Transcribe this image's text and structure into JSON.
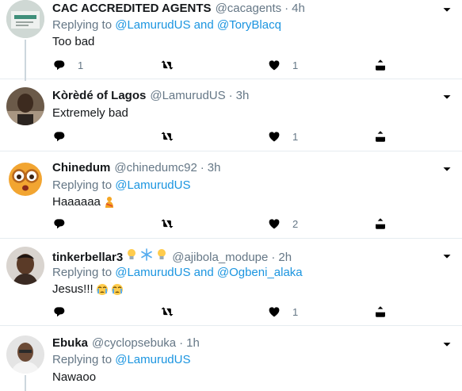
{
  "tweets": [
    {
      "name": "CAC ACCREDITED AGENTS",
      "handle": "@cacagents",
      "separator": "·",
      "time": "4h",
      "replying_prefix": "Replying to ",
      "reply_users": "@LamurudUS and @ToryBlacq",
      "text": "Too bad",
      "reply_count": "1",
      "retweet_count": "",
      "like_count": "1"
    },
    {
      "name": "Kòrèdé of Lagos",
      "handle": "@LamurudUS",
      "separator": "·",
      "time": "3h",
      "text": "Extremely bad",
      "reply_count": "",
      "retweet_count": "",
      "like_count": "1"
    },
    {
      "name": "Chinedum",
      "handle": "@chinedumc92",
      "separator": "·",
      "time": "3h",
      "replying_prefix": "Replying to ",
      "reply_users": "@LamurudUS",
      "text": "Haaaaaa",
      "reply_count": "",
      "retweet_count": "",
      "like_count": "2"
    },
    {
      "name": "tinkerbellar3",
      "handle": "@ajibola_modupe",
      "separator": "·",
      "time": "2h",
      "replying_prefix": "Replying to ",
      "reply_users": "@LamurudUS and @Ogbeni_alaka",
      "text": "Jesus!!!",
      "reply_count": "",
      "retweet_count": "",
      "like_count": "1"
    },
    {
      "name": "Ebuka",
      "handle": "@cyclopsebuka",
      "separator": "·",
      "time": "1h",
      "replying_prefix": "Replying to ",
      "reply_users": "@LamurudUS",
      "text": "Nawaoo"
    }
  ],
  "icons": {
    "reply": "reply-icon",
    "retweet": "retweet-icon",
    "like": "heart-icon",
    "share": "share-icon",
    "more": "chevron-down-icon"
  },
  "colors": {
    "link": "#1b95e0",
    "muted": "#657786",
    "divider": "#e6ecf0",
    "thread_line": "#ccd6dd"
  }
}
